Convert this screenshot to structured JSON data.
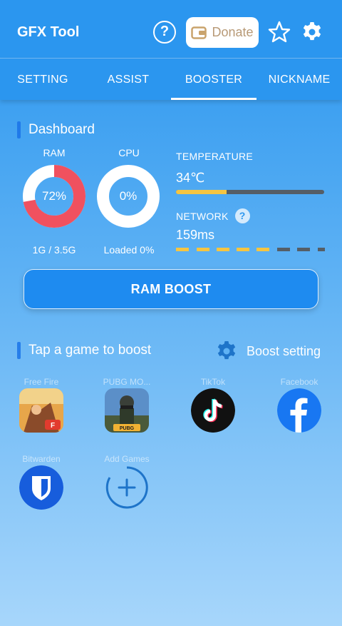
{
  "appbar": {
    "title": "GFX Tool",
    "donate_label": "Donate"
  },
  "tabs": [
    {
      "label": "SETTING",
      "active": false
    },
    {
      "label": "ASSIST",
      "active": false
    },
    {
      "label": "BOOSTER",
      "active": true
    },
    {
      "label": "NICKNAME",
      "active": false
    }
  ],
  "dashboard": {
    "title": "Dashboard",
    "ram": {
      "label": "RAM",
      "percent_text": "72%",
      "percent": 72,
      "usage": "1G / 3.5G"
    },
    "cpu": {
      "label": "CPU",
      "percent_text": "0%",
      "percent": 0,
      "status": "Loaded 0%"
    },
    "temperature": {
      "label": "TEMPERATURE",
      "value": "34℃",
      "fill_percent": 34
    },
    "network": {
      "label": "NETWORK",
      "value": "159ms",
      "help_glyph": "?"
    }
  },
  "boost_button": {
    "label": "RAM BOOST"
  },
  "games_section": {
    "title": "Tap a game to boost",
    "setting_label": "Boost setting"
  },
  "games": [
    {
      "label": "Free Fire",
      "icon": "free-fire-icon"
    },
    {
      "label": "PUBG MO...",
      "icon": "pubg-icon"
    },
    {
      "label": "TikTok",
      "icon": "tiktok-icon"
    },
    {
      "label": "Facebook",
      "icon": "facebook-icon"
    },
    {
      "label": "Bitwarden",
      "icon": "bitwarden-icon"
    },
    {
      "label": "Add Games",
      "icon": "add-icon"
    }
  ],
  "colors": {
    "primary": "#2b96ef",
    "ram_ring": "#f0515f",
    "temp_bar": "#f5c542",
    "track_dark": "#555e66",
    "donate_text": "#b89a77"
  }
}
